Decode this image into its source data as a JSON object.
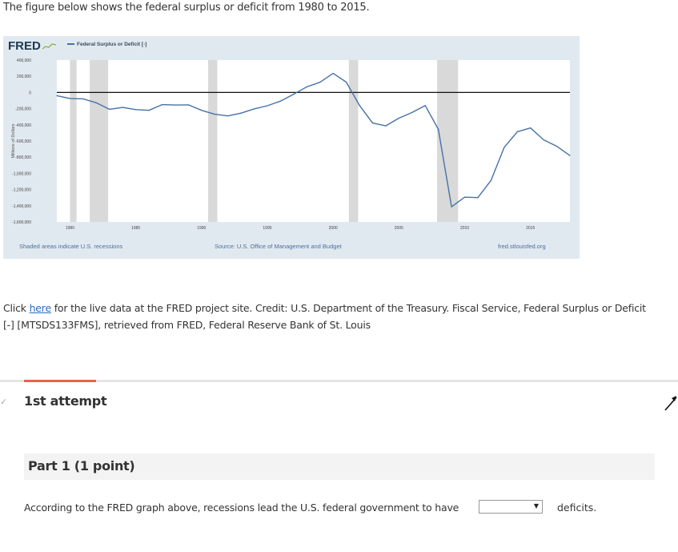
{
  "intro_text": "The figure below shows the federal surplus or deficit from 1980 to 2015.",
  "fred": {
    "logo": "FRED",
    "legend": "Federal Surplus or Deficit [-]",
    "y_axis_label": "Millions of Dollars",
    "recession_note": "Shaded areas indicate U.S. recessions",
    "source": "Source: U.S. Office of Management and Budget",
    "url": "fred.stlouisfed.org",
    "line_color": "#4572a7",
    "recession_color": "#d9d9d9"
  },
  "chart_data": {
    "type": "line",
    "title": "",
    "xlabel": "",
    "ylabel": "Millions of Dollars",
    "x": [
      1979,
      1980,
      1981,
      1982,
      1983,
      1984,
      1985,
      1986,
      1987,
      1988,
      1989,
      1990,
      1991,
      1992,
      1993,
      1994,
      1995,
      1996,
      1997,
      1998,
      1999,
      2000,
      2001,
      2002,
      2003,
      2004,
      2005,
      2006,
      2007,
      2008,
      2009,
      2010,
      2011,
      2012,
      2013,
      2014,
      2015,
      2016
    ],
    "series": [
      {
        "name": "Federal Surplus or Deficit [-]",
        "values": [
          -40000,
          -74000,
          -79000,
          -128000,
          -208000,
          -185000,
          -212000,
          -221000,
          -150000,
          -155000,
          -153000,
          -221000,
          -269000,
          -290000,
          -255000,
          -203000,
          -164000,
          -107000,
          -22000,
          69000,
          126000,
          236000,
          128000,
          -158000,
          -378000,
          -413000,
          -318000,
          -248000,
          -161000,
          -455000,
          -1413000,
          -1294000,
          -1300000,
          -1087000,
          -680000,
          -485000,
          -439000,
          -585000,
          -665000,
          -780000
        ]
      }
    ],
    "x_plot": [
      1979,
      1980,
      1981,
      1982,
      1983,
      1984,
      1985,
      1986,
      1987,
      1988,
      1989,
      1990,
      1991,
      1992,
      1993,
      1994,
      1995,
      1996,
      1997,
      1998,
      1999,
      2000,
      2001,
      2002,
      2003,
      2004,
      2005,
      2006,
      2007,
      2008,
      2009,
      2010,
      2011,
      2012,
      2013,
      2014,
      2015,
      2016,
      2017,
      2018
    ],
    "x_ticks": [
      "1980",
      "1985",
      "1990",
      "1995",
      "2000",
      "2005",
      "2010",
      "2015"
    ],
    "y_ticks": [
      "400,000",
      "200,000",
      "0",
      "-200,000",
      "-400,000",
      "-600,000",
      "-800,000",
      "-1,000,000",
      "-1,200,000",
      "-1,400,000",
      "-1,600,000"
    ],
    "y_tick_values": [
      400000,
      200000,
      0,
      -200000,
      -400000,
      -600000,
      -800000,
      -1000000,
      -1200000,
      -1400000,
      -1600000
    ],
    "xlim": [
      1979,
      2018
    ],
    "ylim": [
      -1600000,
      400000
    ],
    "recessions": [
      [
        1980.0,
        1980.5
      ],
      [
        1981.5,
        1982.9
      ],
      [
        1990.5,
        1991.2
      ],
      [
        2001.2,
        2001.9
      ],
      [
        2007.9,
        2009.5
      ]
    ],
    "zero_line": true,
    "grid": false,
    "legend_position": "top-left"
  },
  "credit": {
    "prefix": "Click ",
    "link": "here",
    "suffix": " for the live data at the FRED project site. Credit: U.S. Department of the Treasury. Fiscal Service, Federal Surplus or Deficit [-] [MTSDS133FMS], retrieved from FRED, Federal Reserve Bank of St. Louis"
  },
  "attempt_label": "1st attempt",
  "part": {
    "title": "Part 1  (1 point)"
  },
  "question": {
    "text": "According to the FRED graph above, recessions lead the U.S. federal government to have",
    "dropdown_value": "",
    "after": "deficits."
  }
}
